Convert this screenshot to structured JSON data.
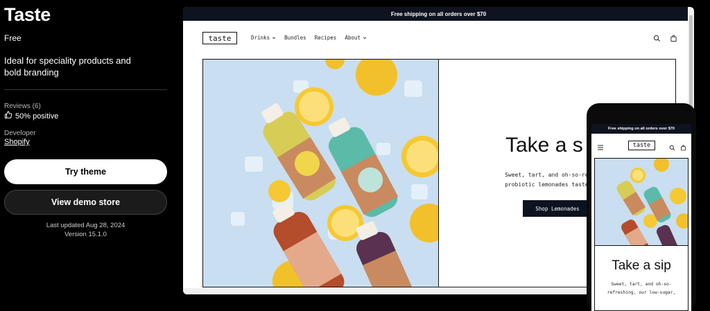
{
  "theme": {
    "name": "Taste",
    "price": "Free",
    "description": "Ideal for speciality products and bold branding",
    "reviews_label": "Reviews (6)",
    "reviews_value": "50% positive",
    "developer_label": "Developer",
    "developer_name": "Shopify",
    "try_button": "Try theme",
    "demo_button": "View demo store",
    "last_updated": "Last updated Aug 28, 2024",
    "version": "Version 15.1.0"
  },
  "preview": {
    "announcement": "Free shipping on all orders over $70",
    "logo": "taste",
    "nav": [
      {
        "label": "Drinks"
      },
      {
        "label": "Bundles"
      },
      {
        "label": "Recipes"
      },
      {
        "label": "About"
      }
    ],
    "hero_title": "Take a s",
    "hero_body_line1": "Sweet, tart, and oh-so-refreshing,",
    "hero_body_line2": "probiotic lemonades taste like sum",
    "hero_button": "Shop Lemonades"
  },
  "mobile": {
    "announcement": "Free shipping on all orders over $70",
    "logo": "taste",
    "hero_title": "Take a sip",
    "body_line1": "Sweet, tart, and oh-so-",
    "body_line2": "refreshing, our low-sugar,"
  },
  "colors": {
    "page_bg": "#000000",
    "announcement_bg": "#0f1320",
    "photo_bg": "#c9def0",
    "button_dark": "#0d1220"
  },
  "icons": [
    "thumbs-up-icon",
    "search-icon",
    "cart-icon",
    "chevron-down-icon",
    "menu-icon"
  ]
}
